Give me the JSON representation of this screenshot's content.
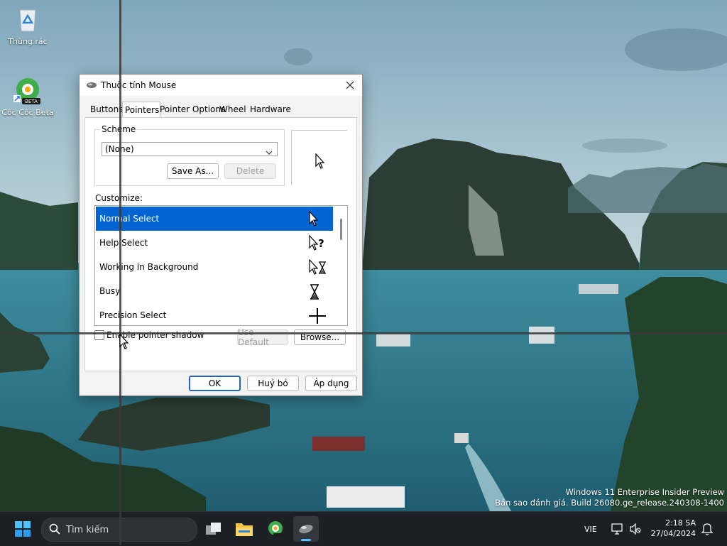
{
  "desktop": {
    "icons": [
      {
        "label": "Thùng rác",
        "icon": "recycle-bin-icon"
      },
      {
        "label": "Cốc Cốc Beta",
        "icon": "coccoc-beta-icon",
        "badge": "BETA"
      }
    ],
    "watermark": {
      "line1": "Windows 11 Enterprise Insider Preview",
      "line2": "Bản sao đánh giá. Build 26080.ge_release.240308-1400"
    }
  },
  "dialog": {
    "title": "Thuộc tính Mouse",
    "tabs": [
      {
        "label": "Buttons",
        "selected": false
      },
      {
        "label": "Pointers",
        "selected": true
      },
      {
        "label": "Pointer Options",
        "selected": false
      },
      {
        "label": "Wheel",
        "selected": false
      },
      {
        "label": "Hardware",
        "selected": false
      }
    ],
    "scheme": {
      "group_label": "Scheme",
      "selected_value": "(None)",
      "save_as_label": "Save As...",
      "delete_label": "Delete"
    },
    "customize": {
      "label": "Customize:",
      "rows": [
        {
          "label": "Normal Select",
          "cursor": "arrow-cursor-icon",
          "selected": true
        },
        {
          "label": "Help Select",
          "cursor": "help-cursor-icon",
          "selected": false
        },
        {
          "label": "Working In Background",
          "cursor": "working-cursor-icon",
          "selected": false
        },
        {
          "label": "Busy",
          "cursor": "hourglass-cursor-icon",
          "selected": false
        },
        {
          "label": "Precision Select",
          "cursor": "crosshair-cursor-icon",
          "selected": false
        }
      ]
    },
    "shadow_label": "Enable pointer shadow",
    "shadow_checked": false,
    "use_default_label": "Use Default",
    "browse_label": "Browse...",
    "ok_label": "OK",
    "cancel_label": "Huỷ bỏ",
    "apply_label": "Áp dụng"
  },
  "taskbar": {
    "search_placeholder": "Tìm kiếm",
    "language": "VIE",
    "time": "2:18 SA",
    "date": "27/04/2024"
  },
  "colors": {
    "selection": "#0065d3",
    "accent": "#1e67c7",
    "taskbar": "#1c1f24"
  }
}
